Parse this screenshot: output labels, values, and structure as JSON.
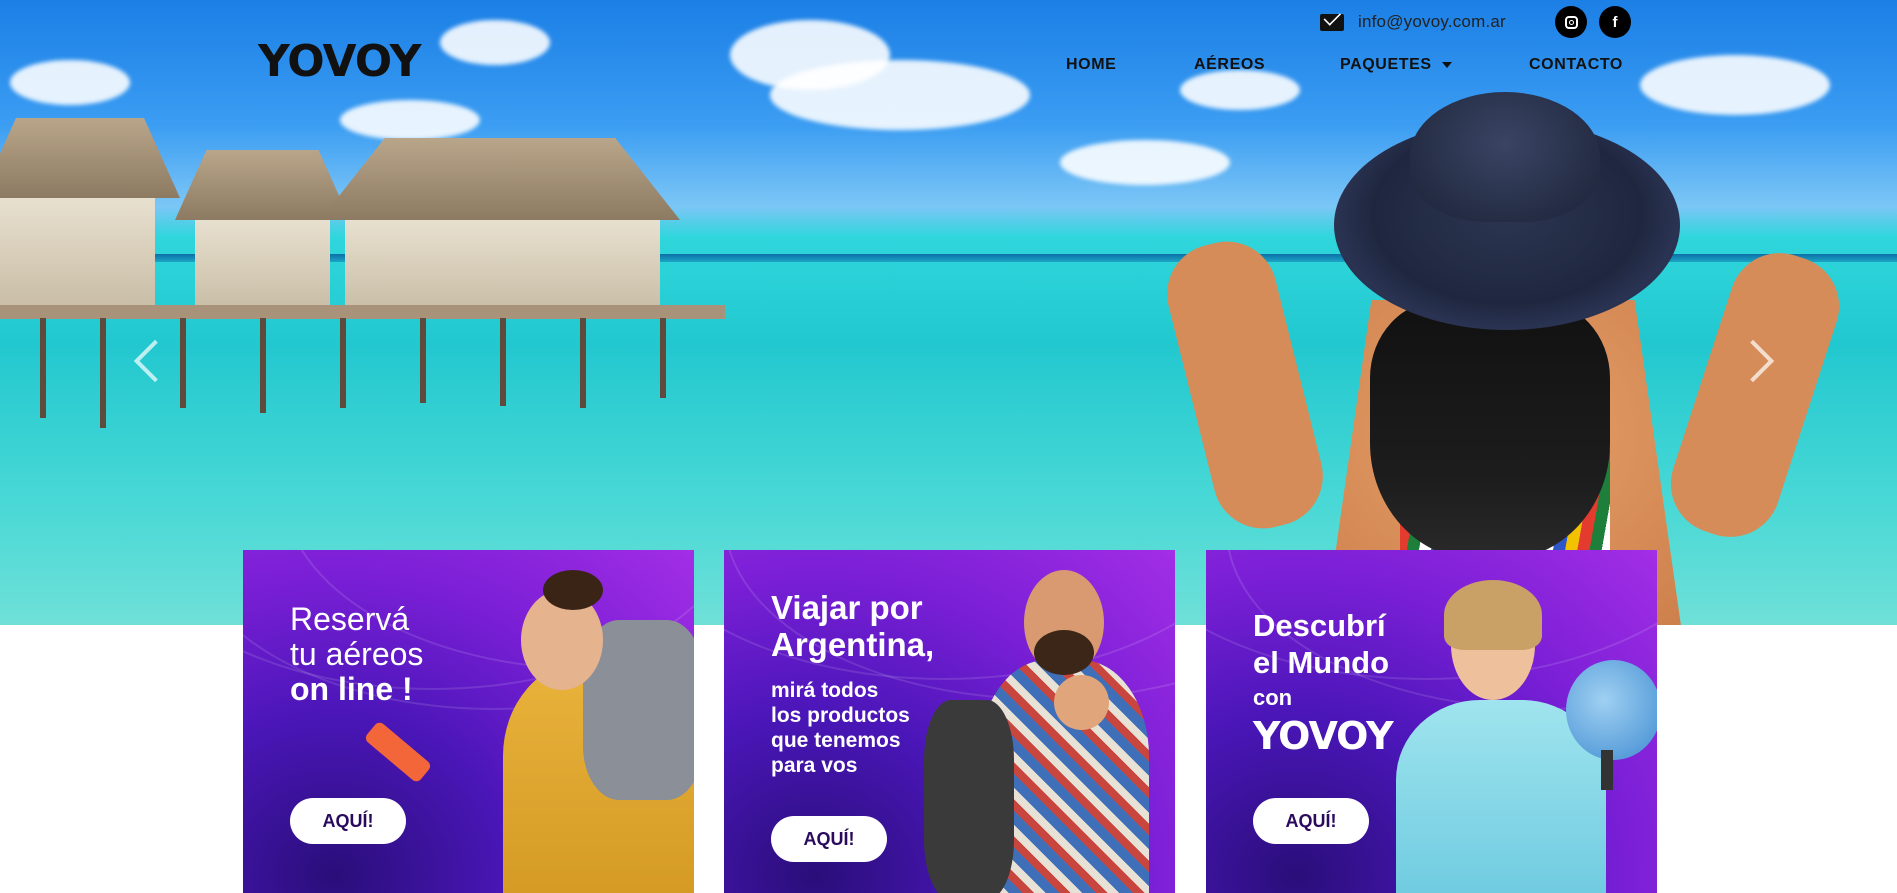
{
  "brand": {
    "logo_text": "YOVOY"
  },
  "topbar": {
    "email_icon": "envelope-icon",
    "email": "info@yovoy.com.ar",
    "socials": [
      {
        "icon": "instagram-icon"
      },
      {
        "icon": "facebook-icon",
        "glyph": "f"
      }
    ]
  },
  "nav": {
    "items": [
      {
        "label": "HOME"
      },
      {
        "label": "AÉREOS"
      },
      {
        "label": "PAQUETES",
        "has_dropdown": true
      },
      {
        "label": "CONTACTO"
      }
    ]
  },
  "hero": {
    "arrows": [
      "chevron-left-icon",
      "chevron-right-icon"
    ]
  },
  "cards": [
    {
      "lines": [
        "Reservá",
        "tu aéreos",
        "on line !"
      ],
      "button": "AQUÍ!"
    },
    {
      "heading": [
        "Viajar por",
        "Argentina,"
      ],
      "sub": [
        "mirá todos",
        "los productos",
        "que tenemos",
        "para vos"
      ],
      "button": "AQUÍ!"
    },
    {
      "heading": [
        "Descubrí",
        "el Mundo"
      ],
      "sub": "con",
      "brand": "YOVOY",
      "button": "AQUÍ!"
    }
  ],
  "colors": {
    "card_purple": "#7a1fd6",
    "button_text": "#2a0a5c",
    "nav_text": "#111111"
  }
}
